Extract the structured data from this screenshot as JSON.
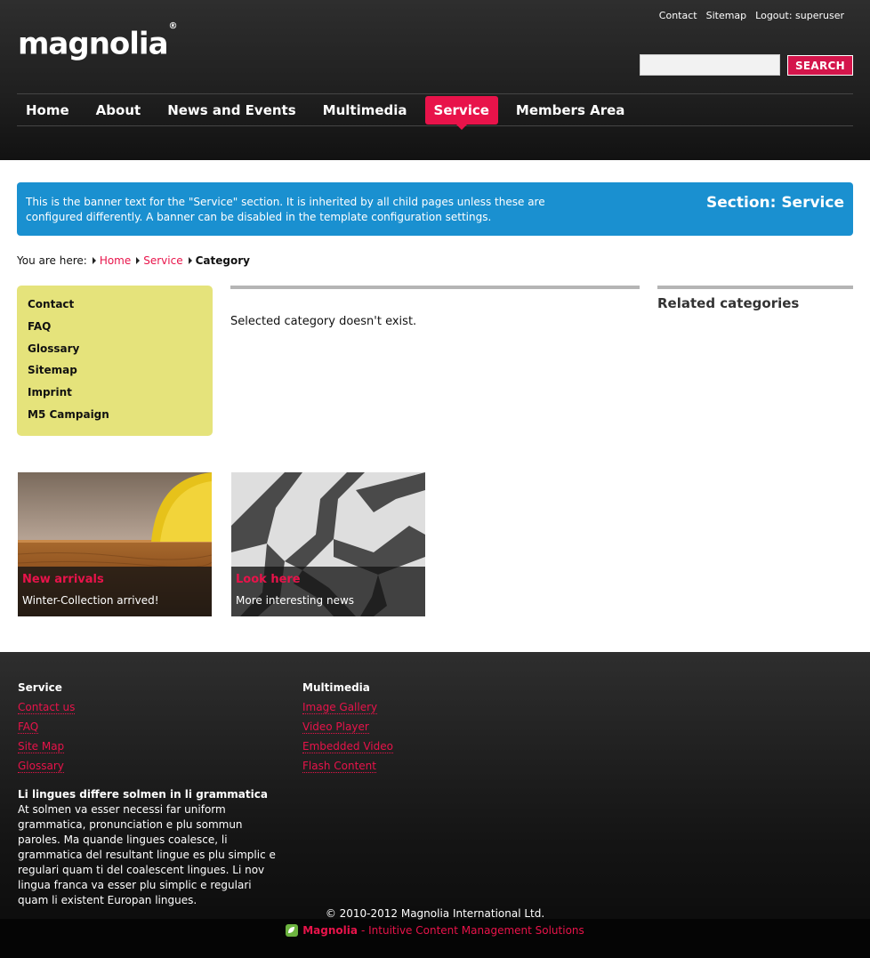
{
  "header": {
    "logo_text": "magnolia",
    "logo_mark": "®",
    "util_links": [
      "Contact",
      "Sitemap",
      "Logout: superuser"
    ],
    "search": {
      "value": "",
      "placeholder": "",
      "button": "SEARCH"
    },
    "nav": [
      {
        "label": "Home",
        "active": false
      },
      {
        "label": "About",
        "active": false
      },
      {
        "label": "News and Events",
        "active": false
      },
      {
        "label": "Multimedia",
        "active": false
      },
      {
        "label": "Service",
        "active": true
      },
      {
        "label": "Members Area",
        "active": false
      }
    ]
  },
  "banner": {
    "text": "This is the banner text for the \"Service\" section. It is inherited by all child pages unless these are configured differently. A banner can be disabled in the template configuration settings.",
    "section": "Section: Service"
  },
  "breadcrumb": {
    "prefix": "You are here:",
    "links": [
      "Home",
      "Service"
    ],
    "current": "Category"
  },
  "subnav": [
    "Contact",
    "FAQ",
    "Glossary",
    "Sitemap",
    "Imprint",
    "M5 Campaign"
  ],
  "main": {
    "message": "Selected category doesn't exist."
  },
  "related": {
    "title": "Related categories"
  },
  "teasers": [
    {
      "title": "New arrivals",
      "subtitle": "Winter-Collection arrived!"
    },
    {
      "title": "Look here",
      "subtitle": "More interesting news"
    }
  ],
  "footer": {
    "columns": [
      {
        "title": "Service",
        "links": [
          "Contact us",
          "FAQ",
          "Site Map",
          "Glossary"
        ]
      },
      {
        "title": "Multimedia",
        "links": [
          "Image Gallery",
          "Video Player",
          "Embedded Video",
          "Flash Content"
        ]
      }
    ],
    "text_title": "Li lingues differe solmen in li grammatica",
    "text_body": "At solmen va esser necessi far uniform grammatica, pronunciation e plu sommun paroles. Ma quande lingues coalesce, li grammatica del resultant lingue es plu simplic e regulari quam ti del coalescent lingues. Li nov lingua franca va esser plu simplic e regulari quam li existent Europan lingues.",
    "copyright": "© 2010-2012 Magnolia International Ltd.",
    "powered_brand": "Magnolia",
    "powered_tagline": "- Intuitive Content Management Solutions"
  },
  "colors": {
    "accent": "#e8134a",
    "banner": "#1a90d0",
    "subnav_bg": "#e5e37b",
    "header_bg": "#262626"
  },
  "icons": [
    "magnolia-icon",
    "breadcrumb-arrow-icon"
  ]
}
